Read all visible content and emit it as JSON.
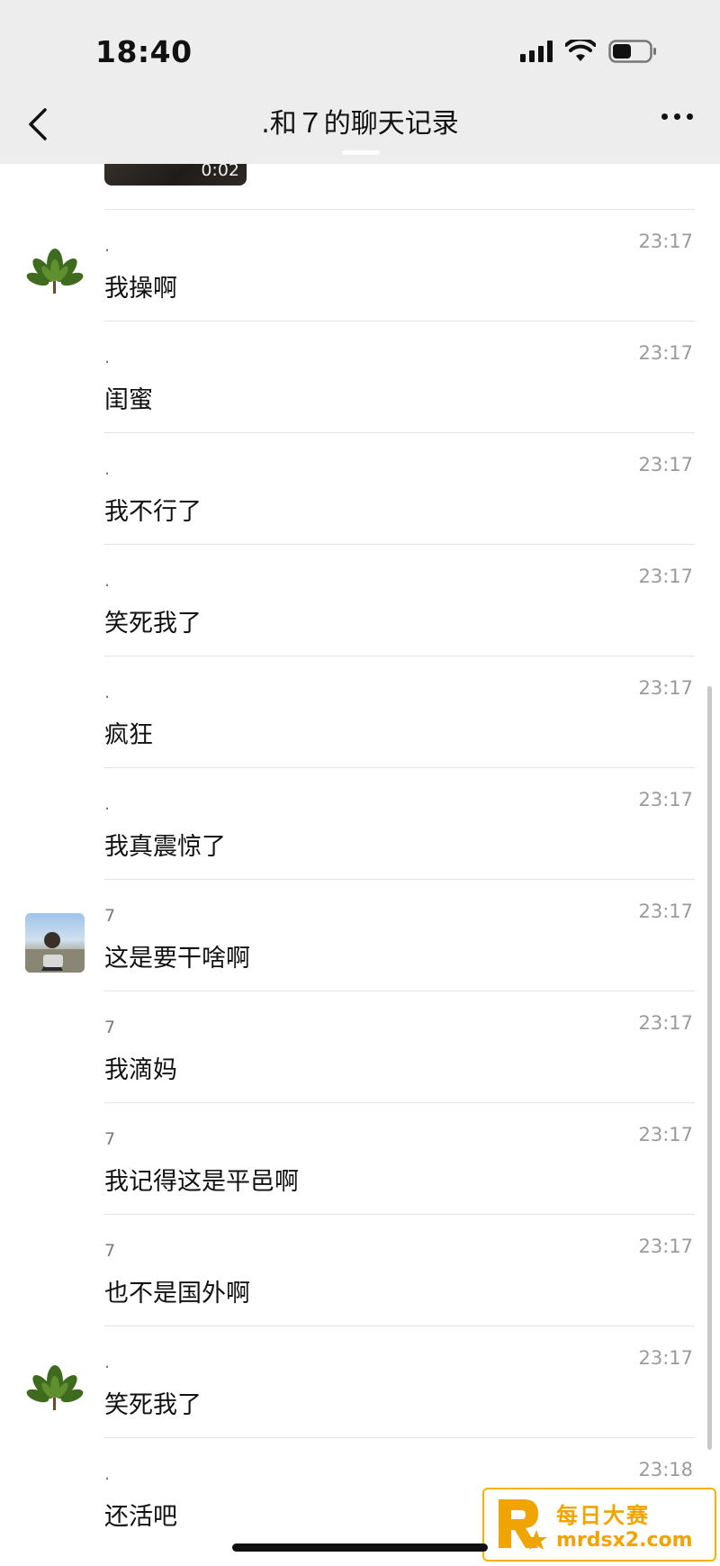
{
  "status_bar": {
    "time": "18:40"
  },
  "nav": {
    "title": ".和７的聊天记录"
  },
  "video": {
    "duration": "0:02"
  },
  "messages": [
    {
      "sender": ".",
      "time": "23:17",
      "text": "我操啊",
      "avatar": "leaf"
    },
    {
      "sender": ".",
      "time": "23:17",
      "text": "闺蜜",
      "avatar": ""
    },
    {
      "sender": ".",
      "time": "23:17",
      "text": "我不行了",
      "avatar": ""
    },
    {
      "sender": ".",
      "time": "23:17",
      "text": "笑死我了",
      "avatar": ""
    },
    {
      "sender": ".",
      "time": "23:17",
      "text": "疯狂",
      "avatar": ""
    },
    {
      "sender": ".",
      "time": "23:17",
      "text": "我真震惊了",
      "avatar": ""
    },
    {
      "sender": "7",
      "time": "23:17",
      "text": "这是要干啥啊",
      "avatar": "photo"
    },
    {
      "sender": "7",
      "time": "23:17",
      "text": "我滴妈",
      "avatar": ""
    },
    {
      "sender": "7",
      "time": "23:17",
      "text": "我记得这是平邑啊",
      "avatar": ""
    },
    {
      "sender": "7",
      "time": "23:17",
      "text": "也不是国外啊",
      "avatar": ""
    },
    {
      "sender": ".",
      "time": "23:17",
      "text": "笑死我了",
      "avatar": "leaf"
    },
    {
      "sender": ".",
      "time": "23:18",
      "text": "还活吧",
      "avatar": ""
    }
  ],
  "watermark": {
    "title": "每日大赛",
    "url": "mrdsx2.com"
  },
  "colors": {
    "nav_bg": "#ededed",
    "time_gray": "#9b9b9b",
    "watermark": "#f0a400"
  }
}
